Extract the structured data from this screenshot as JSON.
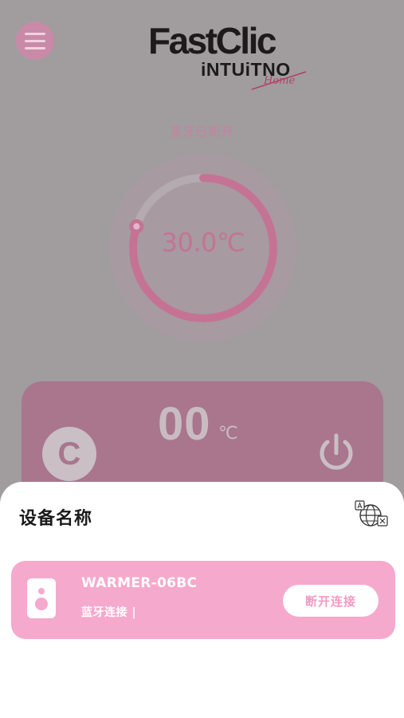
{
  "logo": {
    "main": "FastClic",
    "sub": "iNTUiTNO",
    "script": "Home"
  },
  "status": {
    "bluetooth": "蓝牙已断开"
  },
  "dial": {
    "temperature": "30.0℃",
    "level": 0.8
  },
  "control": {
    "set_value": "00",
    "unit": "℃",
    "celsius_glyph": "C"
  },
  "sheet": {
    "title": "设备名称",
    "device": {
      "name": "WARMER-06BC",
      "status": "蓝牙连接 |",
      "disconnect_label": "断开连接"
    }
  },
  "colors": {
    "accent": "#f5a9cd",
    "overlay": "#a19c9e",
    "dial_pink": "#c47395"
  },
  "icons": [
    "menu-icon",
    "celsius-icon",
    "power-icon",
    "translate-globe-icon",
    "device-icon"
  ]
}
